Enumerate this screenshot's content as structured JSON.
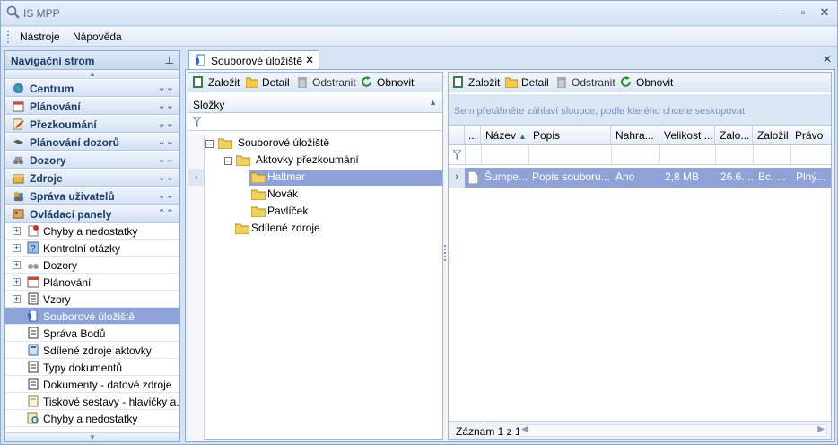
{
  "window": {
    "title": "IS MPP"
  },
  "menu": {
    "items": [
      "Nástroje",
      "Nápověda"
    ]
  },
  "nav": {
    "header": "Navigační strom",
    "groups": [
      "Centrum",
      "Plánování",
      "Přezkoumání",
      "Plánování dozorů",
      "Dozory",
      "Zdroje",
      "Správa uživatelů",
      "Ovládací panely"
    ],
    "items": [
      "Chyby a nedostatky",
      "Kontrolní otázky",
      "Dozory",
      "Plánování",
      "Vzory",
      "Souborové úložiště",
      "Správa Bodů",
      "Sdílené zdroje aktovky",
      "Typy dokumentů",
      "Dokumenty - datové zdroje",
      "Tiskové sestavy - hlavičky a...",
      "Chyby a nedostatky"
    ]
  },
  "tab": {
    "label": "Souborové úložiště"
  },
  "left_toolbar": {
    "create": "Založit",
    "detail": "Detail",
    "remove": "Odstranit",
    "refresh": "Obnovit"
  },
  "right_toolbar": {
    "create": "Založit",
    "detail": "Detail",
    "remove": "Odstranit",
    "refresh": "Obnovit"
  },
  "folders": {
    "header": "Složky",
    "nodes": [
      "Souborové úložiště",
      "Aktovky přezkoumání",
      "Haltmar",
      "Novák",
      "Pavlíček",
      "Sdílené zdroje"
    ]
  },
  "grid": {
    "group_hint": "Sem přetáhněte záhlaví sloupce, podle kterého chcete seskupovat",
    "columns": [
      "...",
      "Název",
      "Popis",
      "Nahra...",
      "Velikost ...",
      "Zalo...",
      "Založil",
      "Právo"
    ],
    "rows": [
      [
        "",
        "Šumpe...",
        "Popis souboru...",
        "Ano",
        "2,8 MB",
        "26.6....",
        "Bc. ...",
        "Plný..."
      ]
    ],
    "footer": "Záznam 1 z 1"
  }
}
